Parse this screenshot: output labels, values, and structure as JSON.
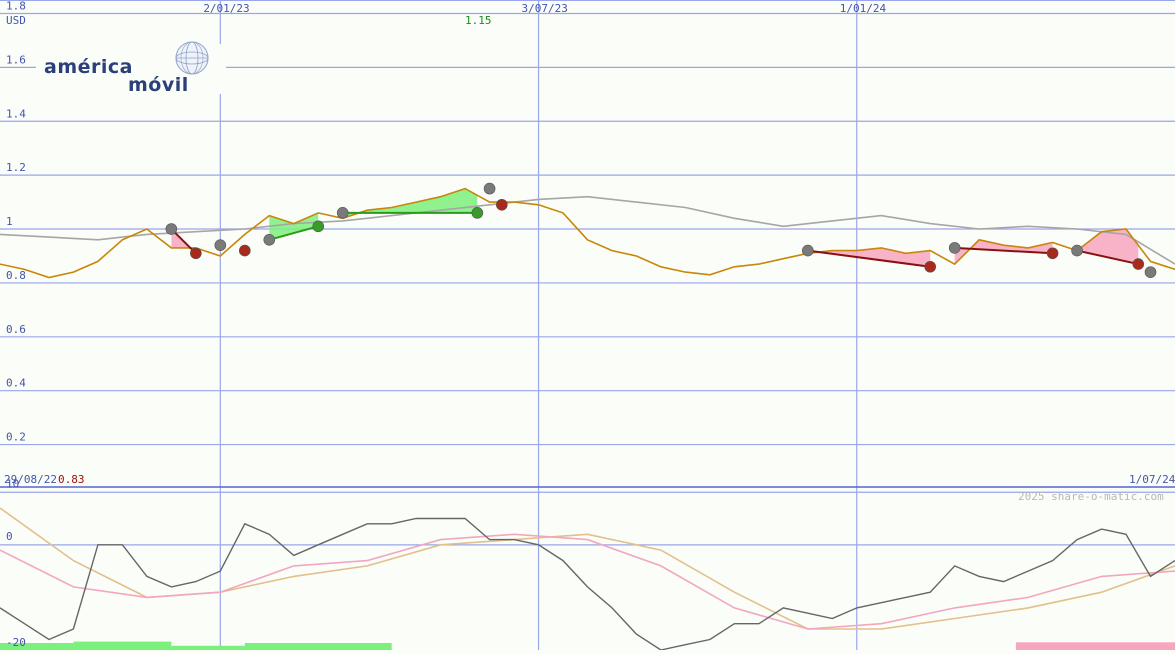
{
  "logo": {
    "word1": "américa",
    "word2": "móvil"
  },
  "currency": "USD",
  "high_label": "1.15",
  "low_label": "0.83",
  "start_date": "29/08/22",
  "end_date": "1/07/24",
  "credit": "2025 share-o-matic.com",
  "colors": {
    "grid": "#9aa6ea",
    "price": "#c8860a",
    "index": "#a6a6a6",
    "gain_fill": "#7cf07c",
    "loss_fill": "#f7a6c0",
    "up_marker": "#3a9a2a",
    "down_marker": "#a82a1a",
    "neutral_marker": "#7a7a7a",
    "up_trend": "#2a9a1a",
    "down_trend": "#8a1010",
    "momentum": "#666666",
    "ma_fast": "#f2a6c0",
    "ma_slow": "#e2c08a",
    "high_text": "#1a8a1a",
    "low_text": "#a01010"
  },
  "chart_data": [
    {
      "type": "line",
      "ylabel": "USD",
      "ylim": [
        0.05,
        1.85
      ],
      "yticks": [
        0.2,
        0.4,
        0.6,
        0.8,
        1,
        1.2,
        1.4,
        1.6,
        1.8
      ],
      "ytick_labels": [
        "0.2",
        "0.4",
        "0.6",
        "0.8",
        "1",
        "1.2",
        "1.4",
        "1.6",
        "1.8"
      ],
      "xlim": [
        "2022-08-29",
        "2024-07-01"
      ],
      "x_ticks": [
        {
          "date": "2023-01-02",
          "label": "2/01/23"
        },
        {
          "date": "2023-07-03",
          "label": "3/07/23"
        },
        {
          "date": "2024-01-01",
          "label": "1/01/24"
        }
      ],
      "grid": true,
      "price_series": {
        "x": [
          "2022-08-29",
          "2022-09-12",
          "2022-09-26",
          "2022-10-10",
          "2022-10-24",
          "2022-11-07",
          "2022-11-21",
          "2022-12-05",
          "2022-12-19",
          "2023-01-02",
          "2023-01-16",
          "2023-01-30",
          "2023-02-13",
          "2023-02-27",
          "2023-03-13",
          "2023-03-27",
          "2023-04-10",
          "2023-04-24",
          "2023-05-08",
          "2023-05-22",
          "2023-06-05",
          "2023-06-19",
          "2023-07-03",
          "2023-07-17",
          "2023-07-31",
          "2023-08-14",
          "2023-08-28",
          "2023-09-11",
          "2023-09-25",
          "2023-10-09",
          "2023-10-23",
          "2023-11-06",
          "2023-11-20",
          "2023-12-04",
          "2023-12-18",
          "2024-01-01",
          "2024-01-15",
          "2024-01-29",
          "2024-02-12",
          "2024-02-26",
          "2024-03-11",
          "2024-03-25",
          "2024-04-08",
          "2024-04-22",
          "2024-05-06",
          "2024-05-20",
          "2024-06-03",
          "2024-06-17",
          "2024-07-01"
        ],
        "y": [
          0.87,
          0.85,
          0.82,
          0.84,
          0.88,
          0.96,
          1.0,
          0.93,
          0.93,
          0.9,
          0.98,
          1.05,
          1.02,
          1.06,
          1.04,
          1.07,
          1.08,
          1.1,
          1.12,
          1.15,
          1.1,
          1.1,
          1.09,
          1.06,
          0.96,
          0.92,
          0.9,
          0.86,
          0.84,
          0.83,
          0.86,
          0.87,
          0.89,
          0.91,
          0.92,
          0.92,
          0.93,
          0.91,
          0.92,
          0.87,
          0.96,
          0.94,
          0.93,
          0.95,
          0.92,
          0.99,
          1.0,
          0.88,
          0.85
        ]
      },
      "index_series": {
        "x": [
          "2022-08-29",
          "2022-09-26",
          "2022-10-24",
          "2022-11-21",
          "2022-12-19",
          "2023-01-16",
          "2023-02-13",
          "2023-03-13",
          "2023-04-10",
          "2023-05-08",
          "2023-06-05",
          "2023-07-03",
          "2023-07-31",
          "2023-08-28",
          "2023-09-25",
          "2023-10-23",
          "2023-11-20",
          "2023-12-18",
          "2024-01-15",
          "2024-02-12",
          "2024-03-11",
          "2024-04-08",
          "2024-05-06",
          "2024-06-03",
          "2024-07-01"
        ],
        "y": [
          0.98,
          0.97,
          0.96,
          0.98,
          0.99,
          1.0,
          1.02,
          1.03,
          1.05,
          1.07,
          1.09,
          1.11,
          1.12,
          1.1,
          1.08,
          1.04,
          1.01,
          1.03,
          1.05,
          1.02,
          1.0,
          1.01,
          1.0,
          0.98,
          0.87
        ]
      },
      "signals": [
        {
          "date": "2022-12-05",
          "y": 1.0,
          "kind": "neutral"
        },
        {
          "date": "2022-12-19",
          "y": 0.91,
          "kind": "down"
        },
        {
          "date": "2023-01-02",
          "y": 0.94,
          "kind": "neutral"
        },
        {
          "date": "2023-01-16",
          "y": 0.92,
          "kind": "down"
        },
        {
          "date": "2023-01-30",
          "y": 0.96,
          "kind": "neutral"
        },
        {
          "date": "2023-02-27",
          "y": 1.01,
          "kind": "up"
        },
        {
          "date": "2023-03-13",
          "y": 1.06,
          "kind": "neutral"
        },
        {
          "date": "2023-05-29",
          "y": 1.06,
          "kind": "up"
        },
        {
          "date": "2023-06-05",
          "y": 1.15,
          "kind": "neutral"
        },
        {
          "date": "2023-06-12",
          "y": 1.09,
          "kind": "down"
        },
        {
          "date": "2023-12-04",
          "y": 0.92,
          "kind": "neutral"
        },
        {
          "date": "2024-02-12",
          "y": 0.86,
          "kind": "down"
        },
        {
          "date": "2024-02-26",
          "y": 0.93,
          "kind": "neutral"
        },
        {
          "date": "2024-04-22",
          "y": 0.91,
          "kind": "down"
        },
        {
          "date": "2024-05-06",
          "y": 0.92,
          "kind": "neutral"
        },
        {
          "date": "2024-06-10",
          "y": 0.87,
          "kind": "down"
        },
        {
          "date": "2024-06-17",
          "y": 0.84,
          "kind": "neutral"
        }
      ],
      "trend_segments": [
        {
          "from": "2022-12-05",
          "from_y": 1.0,
          "to": "2022-12-19",
          "to_y": 0.91,
          "dir": "down"
        },
        {
          "from": "2023-01-30",
          "from_y": 0.96,
          "to": "2023-02-27",
          "to_y": 1.01,
          "dir": "up"
        },
        {
          "from": "2023-03-13",
          "from_y": 1.06,
          "to": "2023-05-29",
          "to_y": 1.06,
          "dir": "up"
        },
        {
          "from": "2023-12-04",
          "from_y": 0.92,
          "to": "2024-02-12",
          "to_y": 0.86,
          "dir": "down"
        },
        {
          "from": "2024-02-26",
          "from_y": 0.93,
          "to": "2024-04-22",
          "to_y": 0.91,
          "dir": "down"
        },
        {
          "from": "2024-05-06",
          "from_y": 0.92,
          "to": "2024-06-10",
          "to_y": 0.87,
          "dir": "down"
        }
      ]
    },
    {
      "type": "line",
      "ylim": [
        -20,
        11
      ],
      "yticks": [
        10,
        0,
        -20
      ],
      "ytick_labels": [
        "10",
        "0",
        "-20"
      ],
      "grid": true,
      "momentum": {
        "x": [
          "2022-08-29",
          "2022-09-12",
          "2022-09-26",
          "2022-10-10",
          "2022-10-24",
          "2022-11-07",
          "2022-11-21",
          "2022-12-05",
          "2022-12-19",
          "2023-01-02",
          "2023-01-16",
          "2023-01-30",
          "2023-02-13",
          "2023-02-27",
          "2023-03-13",
          "2023-03-27",
          "2023-04-10",
          "2023-04-24",
          "2023-05-08",
          "2023-05-22",
          "2023-06-05",
          "2023-06-19",
          "2023-07-03",
          "2023-07-17",
          "2023-07-31",
          "2023-08-14",
          "2023-08-28",
          "2023-09-11",
          "2023-09-25",
          "2023-10-09",
          "2023-10-23",
          "2023-11-06",
          "2023-11-20",
          "2023-12-04",
          "2023-12-18",
          "2024-01-01",
          "2024-01-15",
          "2024-01-29",
          "2024-02-12",
          "2024-02-26",
          "2024-03-11",
          "2024-03-25",
          "2024-04-08",
          "2024-04-22",
          "2024-05-06",
          "2024-05-20",
          "2024-06-03",
          "2024-06-17",
          "2024-07-01"
        ],
        "y": [
          -12,
          -15,
          -18,
          -16,
          0,
          0,
          -6,
          -8,
          -7,
          -5,
          4,
          2,
          -2,
          0,
          2,
          4,
          4,
          5,
          5,
          5,
          1,
          1,
          0,
          -3,
          -8,
          -12,
          -17,
          -20,
          -19,
          -18,
          -15,
          -15,
          -12,
          -13,
          -14,
          -12,
          -11,
          -10,
          -9,
          -4,
          -6,
          -7,
          -5,
          -3,
          1,
          3,
          2,
          -6,
          -3
        ]
      },
      "ma_fast": {
        "x": [
          "2022-08-29",
          "2022-10-10",
          "2022-11-21",
          "2023-01-02",
          "2023-02-13",
          "2023-03-27",
          "2023-05-08",
          "2023-06-19",
          "2023-07-31",
          "2023-09-11",
          "2023-10-23",
          "2023-12-04",
          "2024-01-15",
          "2024-02-26",
          "2024-04-08",
          "2024-05-20",
          "2024-07-01"
        ],
        "y": [
          -1,
          -8,
          -10,
          -9,
          -4,
          -3,
          1,
          2,
          1,
          -4,
          -12,
          -16,
          -15,
          -12,
          -10,
          -6,
          -5
        ]
      },
      "ma_slow": {
        "x": [
          "2022-08-29",
          "2022-10-10",
          "2022-11-21",
          "2023-01-02",
          "2023-02-13",
          "2023-03-27",
          "2023-05-08",
          "2023-06-19",
          "2023-07-31",
          "2023-09-11",
          "2023-10-23",
          "2023-12-04",
          "2024-01-15",
          "2024-02-26",
          "2024-04-08",
          "2024-05-20",
          "2024-07-01"
        ],
        "y": [
          7,
          -3,
          -10,
          -9,
          -6,
          -4,
          0,
          1,
          2,
          -1,
          -9,
          -16,
          -16,
          -14,
          -12,
          -9,
          -4
        ]
      },
      "volume_bars": [
        {
          "from": "2022-08-29",
          "to": "2022-10-10",
          "level": 0.5,
          "kind": "gain"
        },
        {
          "from": "2022-10-10",
          "to": "2022-12-05",
          "level": 0.6,
          "kind": "gain"
        },
        {
          "from": "2022-12-05",
          "to": "2023-01-16",
          "level": 0.3,
          "kind": "gain"
        },
        {
          "from": "2023-01-16",
          "to": "2023-04-10",
          "level": 0.5,
          "kind": "gain"
        },
        {
          "from": "2024-04-01",
          "to": "2024-07-01",
          "level": 0.55,
          "kind": "loss"
        }
      ]
    }
  ]
}
